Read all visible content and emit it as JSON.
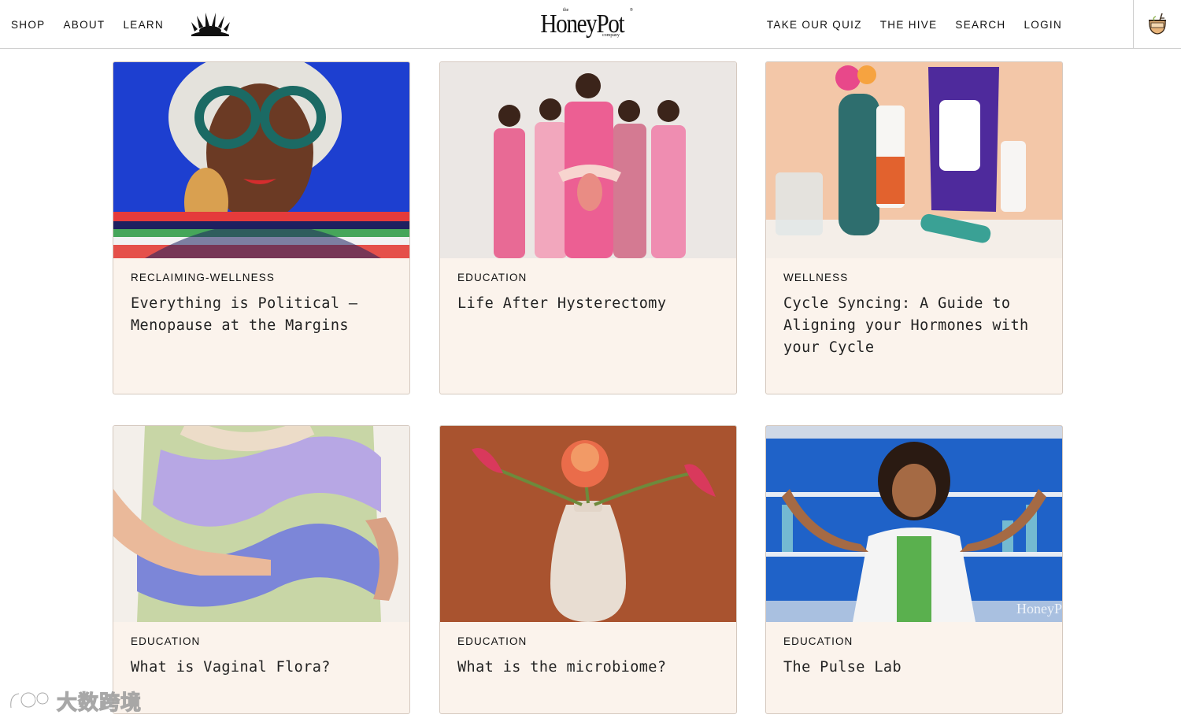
{
  "header": {
    "nav_left": [
      {
        "label": "SHOP"
      },
      {
        "label": "ABOUT"
      },
      {
        "label": "LEARN"
      }
    ],
    "brand": {
      "the": "the",
      "name": "HoneyPot",
      "company": "company",
      "tm": "®"
    },
    "nav_right": [
      {
        "label": "TAKE OUR QUIZ"
      },
      {
        "label": "THE HIVE"
      },
      {
        "label": "SEARCH"
      },
      {
        "label": "LOGIN"
      }
    ],
    "icons": {
      "hive_logo": "sunburst-logo-icon",
      "cart": "honey-pot-cart-icon"
    }
  },
  "cards": [
    {
      "category": "RECLAIMING-WELLNESS",
      "title": "Everything is Political – Menopause at the Margins",
      "image": "woman-with-glasses-portrait"
    },
    {
      "category": "EDUCATION",
      "title": "Life After Hysterectomy",
      "image": "women-in-pink-group"
    },
    {
      "category": "WELLNESS",
      "title": "Cycle Syncing: A Guide to Aligning your Hormones with your Cycle",
      "image": "honeypot-products-still-life"
    },
    {
      "category": "EDUCATION",
      "title": "What is Vaginal Flora?",
      "image": "patterned-dress-closeup"
    },
    {
      "category": "EDUCATION",
      "title": "What is the microbiome?",
      "image": "vase-with-flowers"
    },
    {
      "category": "EDUCATION",
      "title": "The Pulse Lab",
      "image": "scientist-in-lab"
    }
  ],
  "watermark": {
    "text": "大数跨境",
    "logo_text": "1C"
  },
  "colors": {
    "card_bg": "#fbf3ec",
    "card_border": "#d5c9bf",
    "text": "#111111"
  }
}
